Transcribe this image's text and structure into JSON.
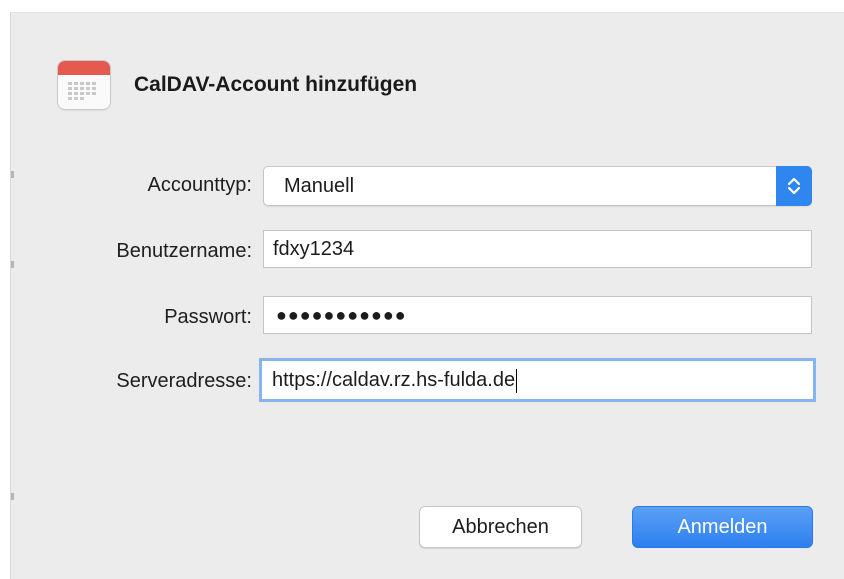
{
  "dialog": {
    "title": "CalDAV-Account hinzufügen",
    "icon": "calendar-icon"
  },
  "form": {
    "account_type": {
      "label": "Accounttyp:",
      "value": "Manuell"
    },
    "username": {
      "label": "Benutzername:",
      "value": "fdxy1234"
    },
    "password": {
      "label": "Passwort:",
      "value": "●●●●●●●●●●●"
    },
    "server": {
      "label": "Serveradresse:",
      "value": "https://caldav.rz.hs-fulda.de"
    }
  },
  "buttons": {
    "cancel": "Abbrechen",
    "confirm": "Anmelden"
  },
  "colors": {
    "accent": "#2f86ef",
    "focus_ring": "#86b4ee",
    "calendar_red": "#e45a4f",
    "dialog_bg": "#ececec"
  }
}
